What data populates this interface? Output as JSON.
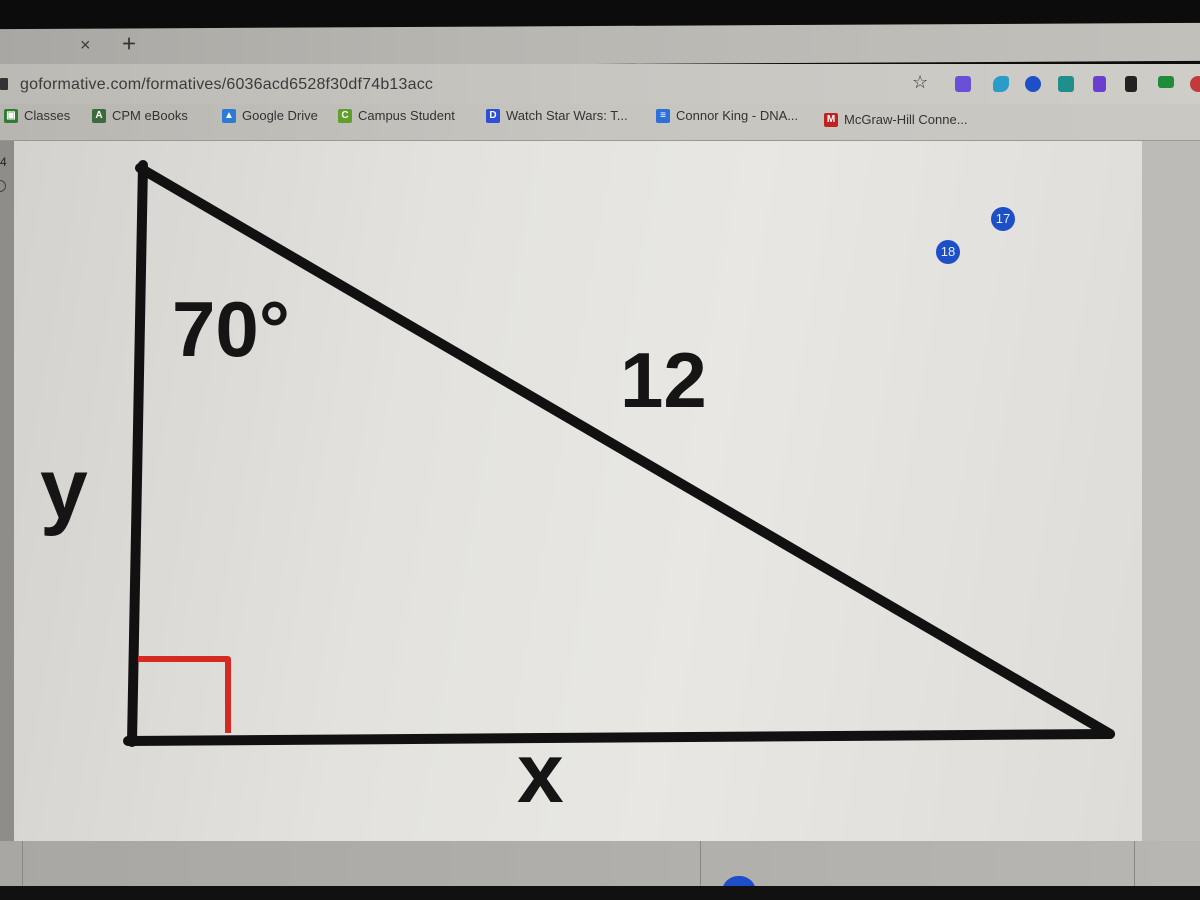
{
  "browser": {
    "tab": {
      "close_glyph": "×",
      "new_tab_glyph": "+"
    },
    "url": "goformative.com/formatives/6036acd6528f30df74b13acc",
    "bookmark_star_glyph": "☆",
    "extensions": [
      {
        "name": "extension-puzzle",
        "color": "#6a4fd8"
      },
      {
        "name": "extension-arrow",
        "color": "#2a9cc7"
      },
      {
        "name": "extension-circle",
        "color": "#1d4fc7"
      },
      {
        "name": "extension-cloud",
        "color": "#1e8f8a"
      },
      {
        "name": "extension-flag",
        "color": "#6a3fd0"
      },
      {
        "name": "extension-robot",
        "color": "#222222"
      },
      {
        "name": "extension-cast",
        "color": "#1f8c3a"
      },
      {
        "name": "extension-chrome",
        "color": "#c23a3a"
      }
    ],
    "bookmarks": [
      {
        "label": "Classes",
        "icon": "classroom-icon",
        "color": "#2f7d32",
        "glyph": "▣"
      },
      {
        "label": "CPM eBooks",
        "icon": "cpm-icon",
        "color": "#3b6b3a",
        "glyph": "A"
      },
      {
        "label": "Google Drive",
        "icon": "drive-icon",
        "color": "#2d7bd6",
        "glyph": "▲"
      },
      {
        "label": "Campus Student",
        "icon": "campus-icon",
        "color": "#5ea02a",
        "glyph": "C"
      },
      {
        "label": "Watch Star Wars: T...",
        "icon": "disney-icon",
        "color": "#2c4fd6",
        "glyph": "D"
      },
      {
        "label": "Connor King - DNA...",
        "icon": "docs-icon",
        "color": "#2f6fd8",
        "glyph": "≡"
      },
      {
        "label": "McGraw-Hill Conne...",
        "icon": "mcgraw-icon",
        "color": "#c0221f",
        "glyph": "M"
      }
    ]
  },
  "gutter": {
    "number": "4"
  },
  "badges": [
    "17",
    "18"
  ],
  "figure": {
    "angle_label": "70°",
    "hypotenuse_label": "12",
    "vertical_side_label": "y",
    "horizontal_side_label": "x",
    "right_angle_color": "#d42a22",
    "line_color": "#111111"
  }
}
